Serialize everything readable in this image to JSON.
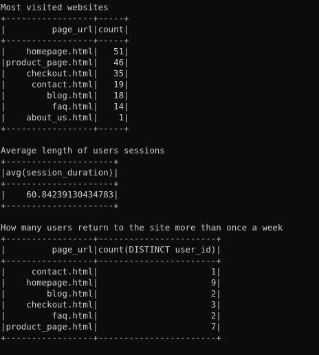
{
  "terminal": {
    "lines": [
      "Most visited websites",
      "+-----------------+-----+",
      "|         page_url|count|",
      "+-----------------+-----+",
      "|    homepage.html|   51|",
      "|product_page.html|   46|",
      "|    checkout.html|   35|",
      "|     contact.html|   19|",
      "|        blog.html|   18|",
      "|         faq.html|   14|",
      "|    about_us.html|    1|",
      "+-----------------+-----+",
      "",
      "Average length of users sessions",
      "+---------------------+",
      "|avg(session_duration)|",
      "+---------------------+",
      "|    60.84239130434783|",
      "+---------------------+",
      "",
      "How many users return to the site more than once a week",
      "+-----------------+-----------------------+",
      "|         page_url|count(DISTINCT user_id)|",
      "+-----------------+-----------------------+",
      "|     contact.html|                      1|",
      "|    homepage.html|                      9|",
      "|        blog.html|                      2|",
      "|    checkout.html|                      3|",
      "|         faq.html|                      2|",
      "|product_page.html|                      7|",
      "+-----------------+-----------------------+"
    ]
  }
}
